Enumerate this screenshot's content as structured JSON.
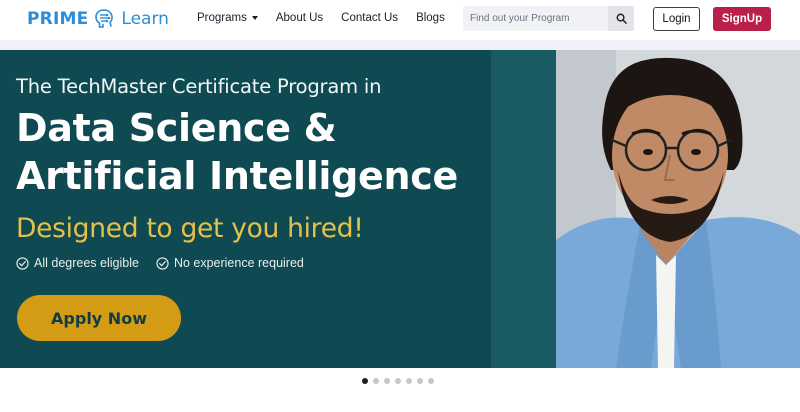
{
  "brand": {
    "name_prefix": "PRIME",
    "name_suffix": "Learn",
    "color": "#2a8fd8"
  },
  "nav": {
    "items": [
      {
        "label": "Programs",
        "has_dropdown": true
      },
      {
        "label": "About Us"
      },
      {
        "label": "Contact Us"
      },
      {
        "label": "Blogs"
      }
    ]
  },
  "search": {
    "placeholder": "Find out your Program",
    "icon": "search-icon"
  },
  "auth": {
    "login_label": "Login",
    "signup_label": "SignUp",
    "signup_color": "#b8204a"
  },
  "hero": {
    "kicker": "The TechMaster Certificate Program in",
    "title_line1": "Data Science &",
    "title_line2": "Artificial Intelligence",
    "subtitle": "Designed to get you hired!",
    "subtitle_color": "#e5c04a",
    "features": [
      {
        "icon": "check-circle-icon",
        "label": "All degrees eligible"
      },
      {
        "icon": "check-circle-icon",
        "label": "No experience required"
      }
    ],
    "cta_label": "Apply Now",
    "cta_color": "#d49b14",
    "background_color": "#0f4a52",
    "image": "man-with-glasses-portrait"
  },
  "carousel": {
    "total_slides": 7,
    "active_index": 0
  }
}
